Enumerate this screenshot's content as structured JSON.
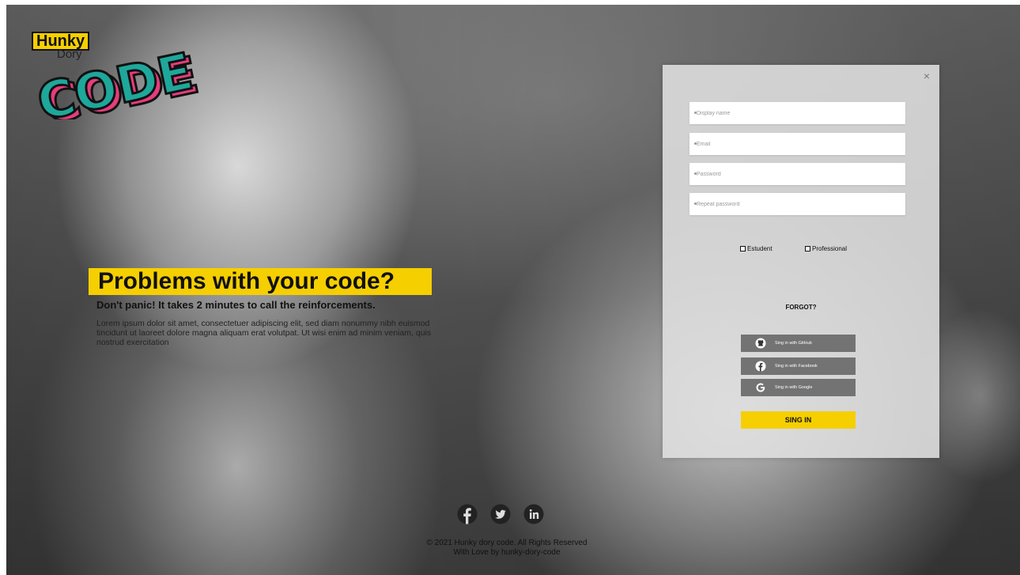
{
  "logo": {
    "line1": "Hunky",
    "line2": "Dory",
    "word": "CODE"
  },
  "hero": {
    "title": "Problems with your code?",
    "subtitle": "Don't panic! It takes 2 minutes to call the reinforcements.",
    "body": "Lorem ipsum dolor sit amet, consectetuer adipiscing elit, sed diam nonummy nibh euismod tincidunt ut laoreet dolore magna aliquam erat volutpat. Ut wisi enim ad minim veniam, quis nostrud exercitation"
  },
  "form": {
    "close": "×",
    "fields": {
      "display_name": "Display name",
      "email": "Email",
      "password": "Password",
      "repeat_password": "Repeat password"
    },
    "options": {
      "student": "Estudent",
      "professional": "Professional"
    },
    "forgot": "FORGOT?",
    "social": {
      "github": "Sing in with GitHub",
      "facebook": "Sing in with Facebook",
      "google": "Sing in with Google"
    },
    "submit": "SING IN"
  },
  "footer": {
    "copyright": "© 2021 Hunky dory code. All Rights Reserved",
    "credit": "With Love by hunky-dory-code"
  },
  "icons": [
    "facebook-icon",
    "twitter-icon",
    "linkedin-icon",
    "github-icon",
    "google-icon",
    "close-icon"
  ],
  "colors": {
    "accent": "#f5cf00",
    "button": "#737373",
    "logo_teal": "#1fa79b",
    "logo_pink": "#e53d7c"
  }
}
